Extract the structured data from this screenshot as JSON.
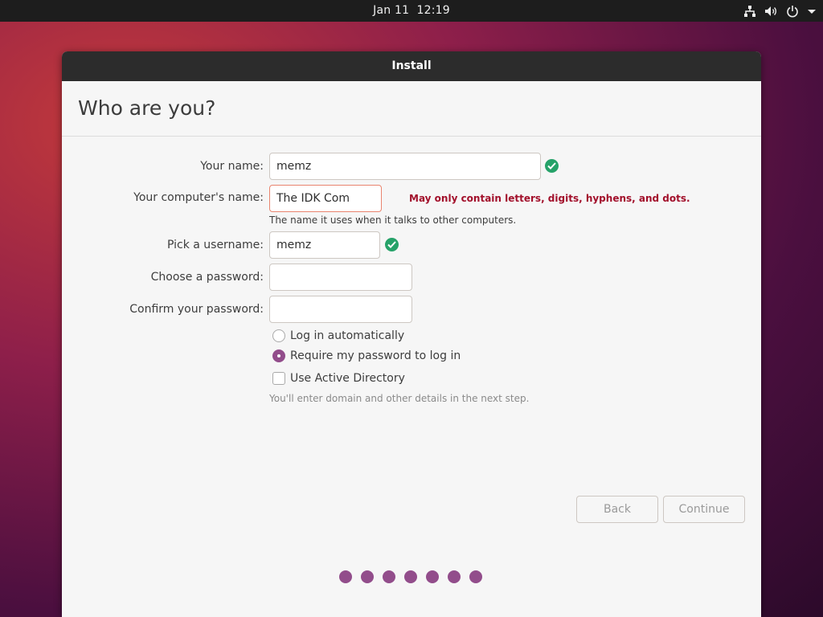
{
  "topbar": {
    "date": "Jan 11",
    "time": "12:19",
    "icons": [
      "network-icon",
      "volume-icon",
      "power-icon",
      "menu-arrow-icon"
    ]
  },
  "window": {
    "title": "Install",
    "heading": "Who are you?"
  },
  "form": {
    "name_label": "Your name:",
    "name_value": "memz",
    "computer_label": "Your computer's name:",
    "computer_value": "The IDK Com",
    "computer_error": "May only contain letters, digits, hyphens, and dots.",
    "computer_hint": "The name it uses when it talks to other computers.",
    "username_label": "Pick a username:",
    "username_value": "memz",
    "password_label": "Choose a password:",
    "password_value": "",
    "confirm_label": "Confirm your password:",
    "confirm_value": ""
  },
  "options": {
    "auto_login": "Log in automatically",
    "auto_login_selected": false,
    "require_password": "Require my password to log in",
    "require_password_selected": true,
    "active_directory": "Use Active Directory",
    "active_directory_checked": false,
    "active_directory_hint": "You'll enter domain and other details in the next step."
  },
  "buttons": {
    "back": "Back",
    "continue": "Continue"
  },
  "progress": {
    "steps_total": 7
  },
  "colors": {
    "accent": "#924d8b",
    "valid": "#26a269",
    "error_text": "#a2102b",
    "error_border": "#e9856f"
  }
}
